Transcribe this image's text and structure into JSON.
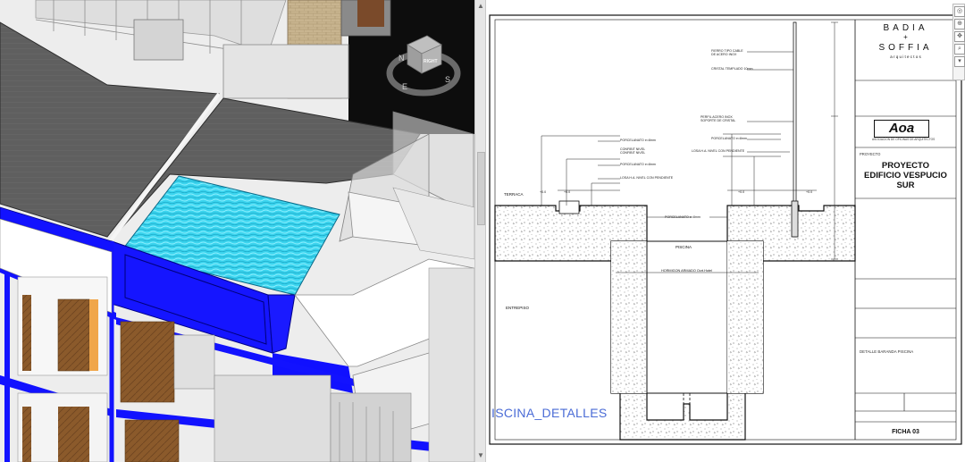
{
  "model_view": {
    "viewcube_face": "RIGHT",
    "compass": {
      "north": "N",
      "east": "E",
      "south": "S"
    }
  },
  "sheet_view": {
    "view_label": "ISCINA_DETALLES",
    "labels": {
      "terrace": "TERRACA",
      "pool": "PISCINA",
      "entrance": "ENTREPISO",
      "concrete": "HORMIGON ARMADO Ocrt.Hotel"
    }
  },
  "title_block": {
    "firm_line1": "BADIA",
    "firm_plus": "+",
    "firm_line2": "SOFFIA",
    "firm_line3": "a r q u i t e c t o s",
    "logo": "Aoa",
    "logo_caption": "ASOCIACION DE OFICINAS DE ARQUITECTOS",
    "project_label": "PROYECTO",
    "project_line1": "PROYECTO",
    "project_line2": "EDIFICIO VESPUCIO",
    "project_line3": "SUR",
    "detail_title": "DETALLE BARANDA PISCINA",
    "sheet_number": "FICHA 03"
  },
  "colors": {
    "accent_blue": "#1010ff",
    "water": "#35d6f0",
    "roof": "#5c5c5c",
    "wood": "#8a5a2b",
    "label_blue": "#4a6bd6"
  }
}
